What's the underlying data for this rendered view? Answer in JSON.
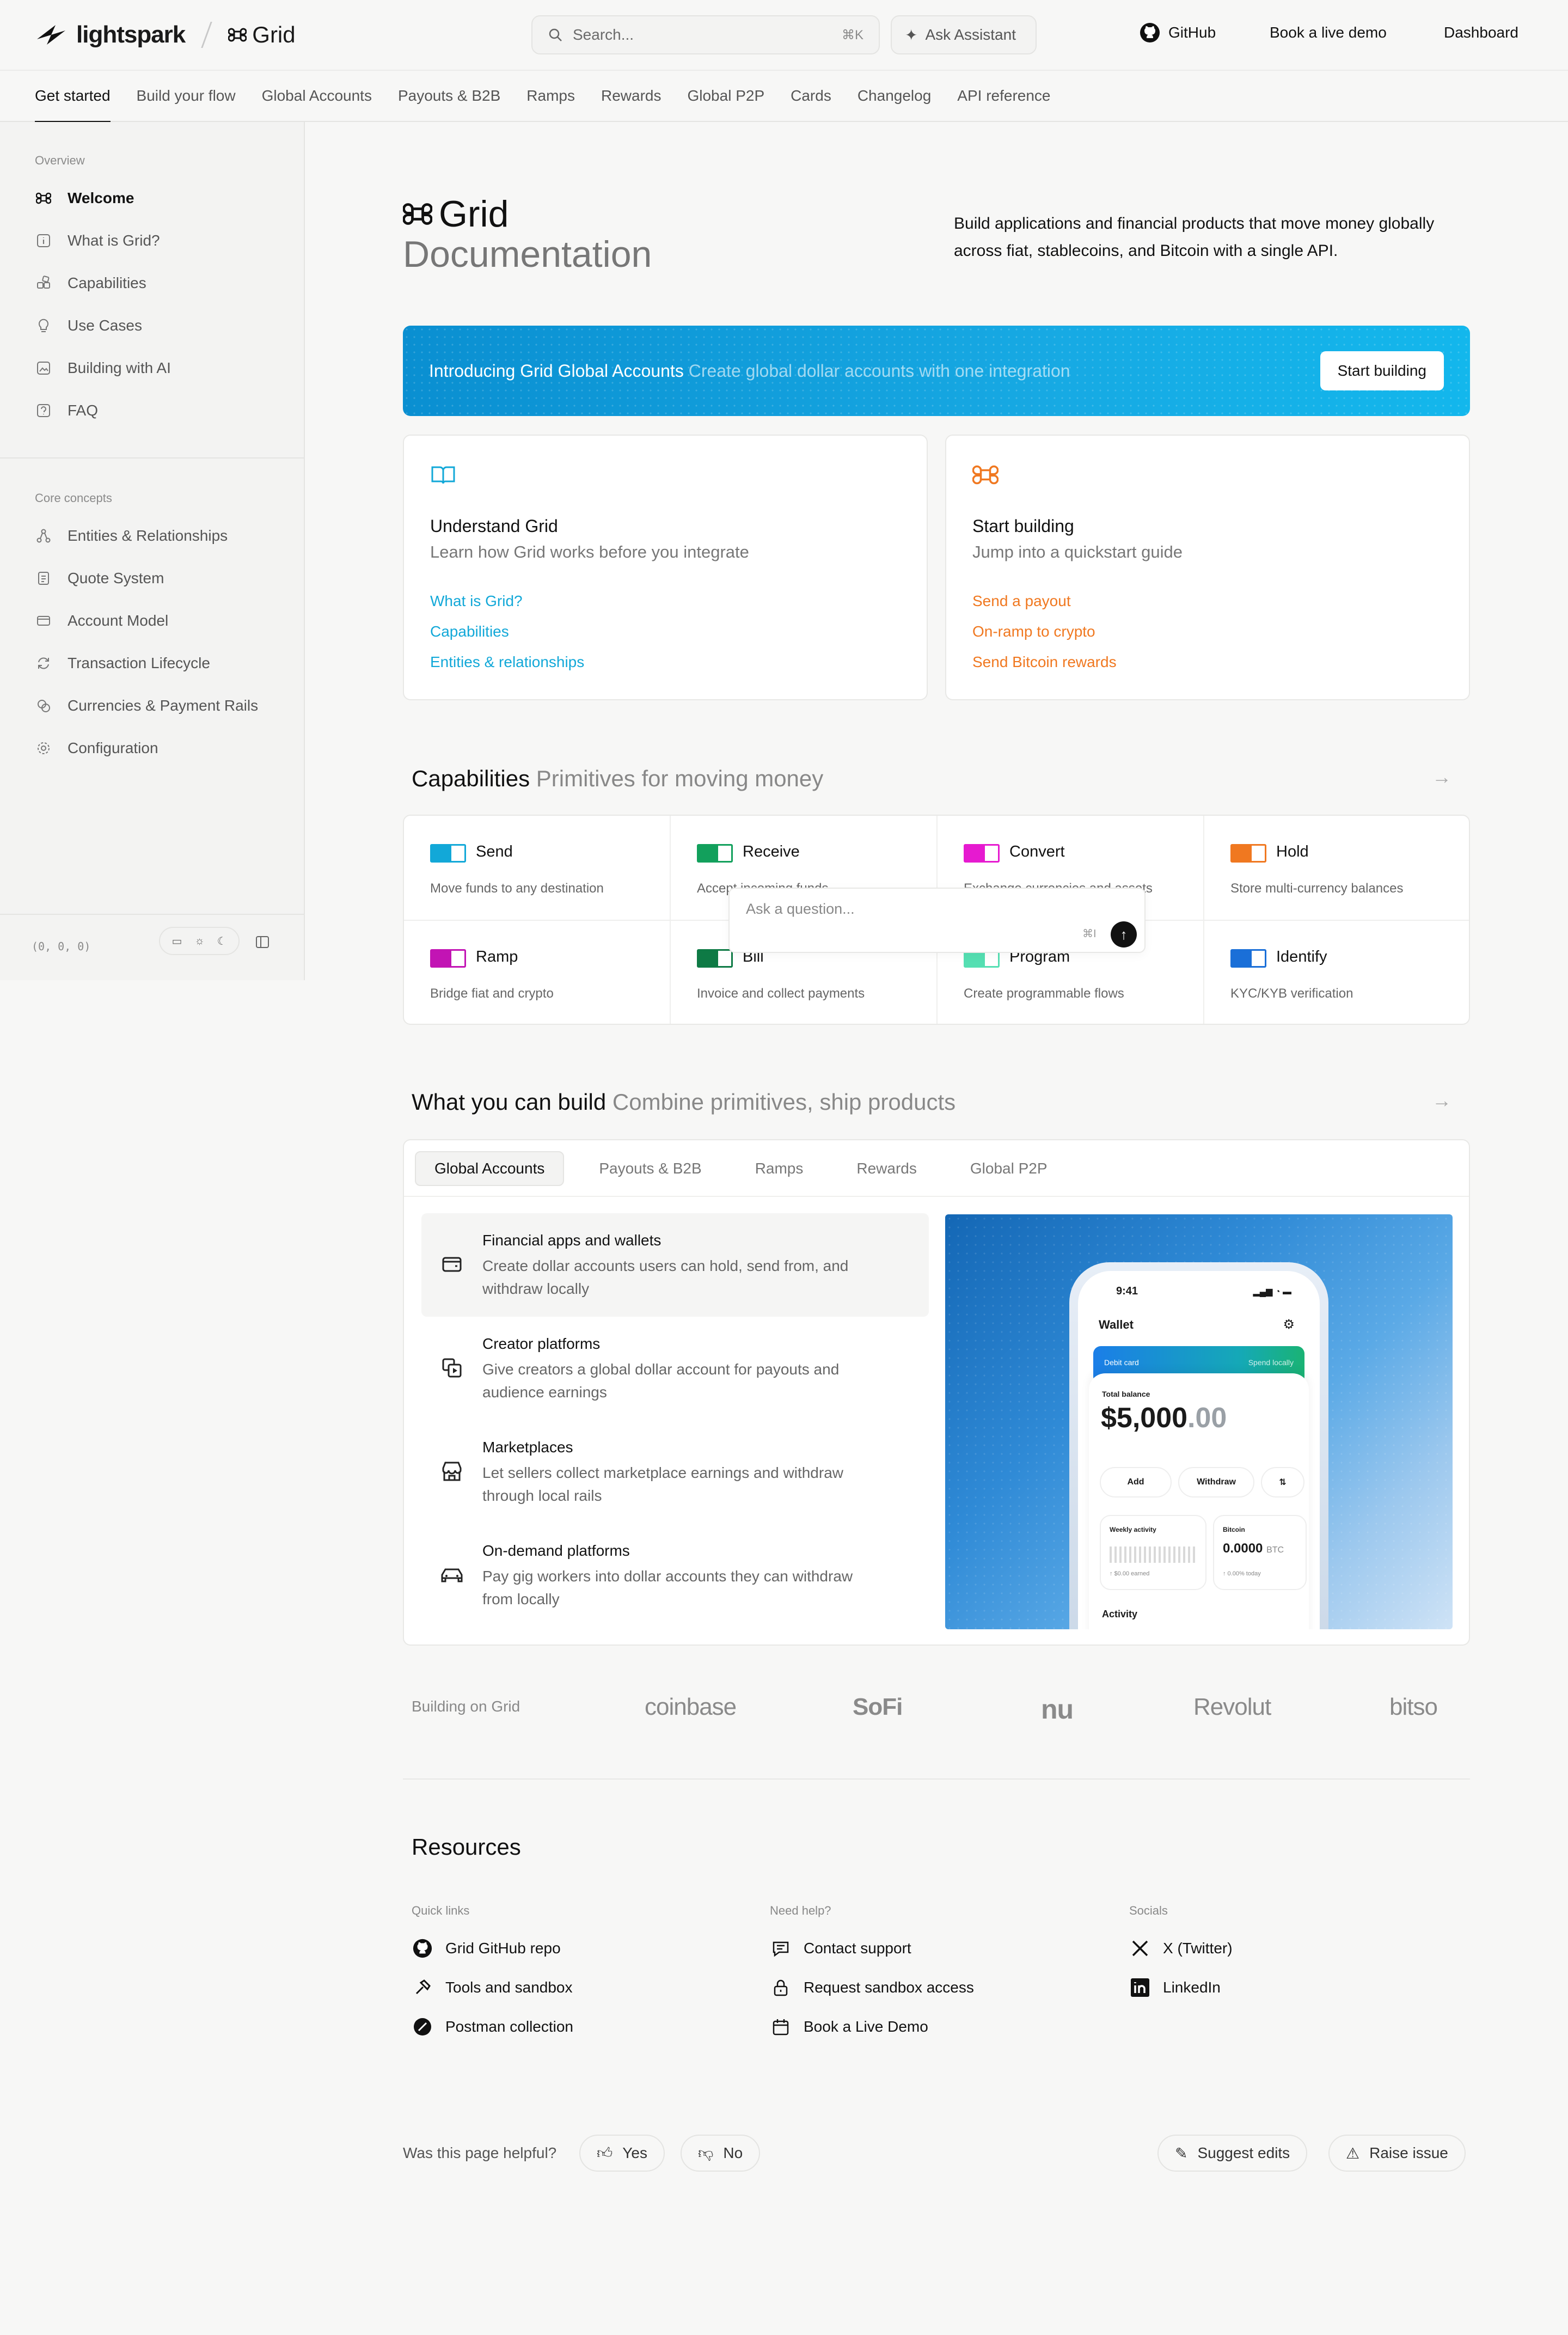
{
  "header": {
    "brand": "lightspark",
    "product": "Grid",
    "search_placeholder": "Search...",
    "search_shortcut": "⌘K",
    "assistant_label": "Ask Assistant",
    "links": {
      "github": "GitHub",
      "demo": "Book a live demo",
      "dashboard": "Dashboard"
    }
  },
  "tabs": [
    "Get started",
    "Build your flow",
    "Global Accounts",
    "Payouts & B2B",
    "Ramps",
    "Rewards",
    "Global P2P",
    "Cards",
    "Changelog",
    "API reference"
  ],
  "sidebar": {
    "overview_label": "Overview",
    "overview_items": [
      "Welcome",
      "What is Grid?",
      "Capabilities",
      "Use Cases",
      "Building with AI",
      "FAQ"
    ],
    "core_label": "Core concepts",
    "core_items": [
      "Entities & Relationships",
      "Quote System",
      "Account Model",
      "Transaction Lifecycle",
      "Currencies & Payment Rails",
      "Configuration"
    ],
    "coords": "(0, 0, 0)"
  },
  "hero": {
    "title": "Grid",
    "subtitle": "Documentation",
    "description": "Build applications and financial products that move money globally across fiat, stablecoins, and Bitcoin with a single API."
  },
  "banner": {
    "title": "Introducing Grid Global Accounts",
    "subtitle": "Create global dollar accounts with one integration",
    "button": "Start building"
  },
  "cards": {
    "understand": {
      "title": "Understand Grid",
      "subtitle": "Learn how Grid works before you integrate",
      "links": [
        "What is Grid?",
        "Capabilities",
        "Entities & relationships"
      ]
    },
    "start": {
      "title": "Start building",
      "subtitle": "Jump into a quickstart guide",
      "links": [
        "Send a payout",
        "On-ramp to crypto",
        "Send Bitcoin rewards"
      ]
    }
  },
  "capabilities": {
    "title": "Capabilities",
    "subtitle": "Primitives for moving money",
    "items": [
      {
        "name": "Send",
        "desc": "Move funds to any destination",
        "color": "#12a8d8"
      },
      {
        "name": "Receive",
        "desc": "Accept incoming funds",
        "color": "#12a05c"
      },
      {
        "name": "Convert",
        "desc": "Exchange currencies and assets",
        "color": "#e61ad0"
      },
      {
        "name": "Hold",
        "desc": "Store multi-currency balances",
        "color": "#f07820"
      },
      {
        "name": "Ramp",
        "desc": "Bridge fiat and crypto",
        "color": "#c214b4"
      },
      {
        "name": "Bill",
        "desc": "Invoice and collect payments",
        "color": "#0e7a45"
      },
      {
        "name": "Program",
        "desc": "Create programmable flows",
        "color": "#55dfb2"
      },
      {
        "name": "Identify",
        "desc": "KYC/KYB verification",
        "color": "#1a6fd8"
      }
    ]
  },
  "ask": {
    "placeholder": "Ask a question...",
    "shortcut": "⌘I"
  },
  "build": {
    "title": "What you can build",
    "subtitle": "Combine primitives, ship products",
    "tabs": [
      "Global Accounts",
      "Payouts & B2B",
      "Ramps",
      "Rewards",
      "Global P2P"
    ],
    "items": [
      {
        "title": "Financial apps and wallets",
        "desc": "Create dollar accounts users can hold, send from, and withdraw locally"
      },
      {
        "title": "Creator platforms",
        "desc": "Give creators a global dollar account for payouts and audience earnings"
      },
      {
        "title": "Marketplaces",
        "desc": "Let sellers collect marketplace earnings and withdraw through local rails"
      },
      {
        "title": "On-demand platforms",
        "desc": "Pay gig workers into dollar accounts they can withdraw from locally"
      }
    ],
    "phone": {
      "time": "9:41",
      "wallet": "Wallet",
      "debit": "Debit card",
      "spend": "Spend locally",
      "total_label": "Total balance",
      "balance_main": "$5,000",
      "balance_cents": ".00",
      "btn_add": "Add",
      "btn_withdraw": "Withdraw",
      "weekly": "Weekly activity",
      "earned": "↑ $0.00 earned",
      "bitcoin": "Bitcoin",
      "btc_value": "0.0000",
      "btc_unit": "BTC",
      "btc_today": "↑ 0.00% today",
      "activity": "Activity"
    }
  },
  "logos": {
    "label": "Building on Grid",
    "brands": [
      "coinbase",
      "SoFi",
      "nu",
      "Revolut",
      "bitso"
    ]
  },
  "resources": {
    "title": "Resources",
    "quick_label": "Quick links",
    "quick": [
      "Grid GitHub repo",
      "Tools and sandbox",
      "Postman collection"
    ],
    "help_label": "Need help?",
    "help": [
      "Contact support",
      "Request sandbox access",
      "Book a Live Demo"
    ],
    "social_label": "Socials",
    "social": [
      "X (Twitter)",
      "LinkedIn"
    ]
  },
  "feedback": {
    "question": "Was this page helpful?",
    "yes": "Yes",
    "no": "No",
    "suggest": "Suggest edits",
    "raise": "Raise issue"
  }
}
